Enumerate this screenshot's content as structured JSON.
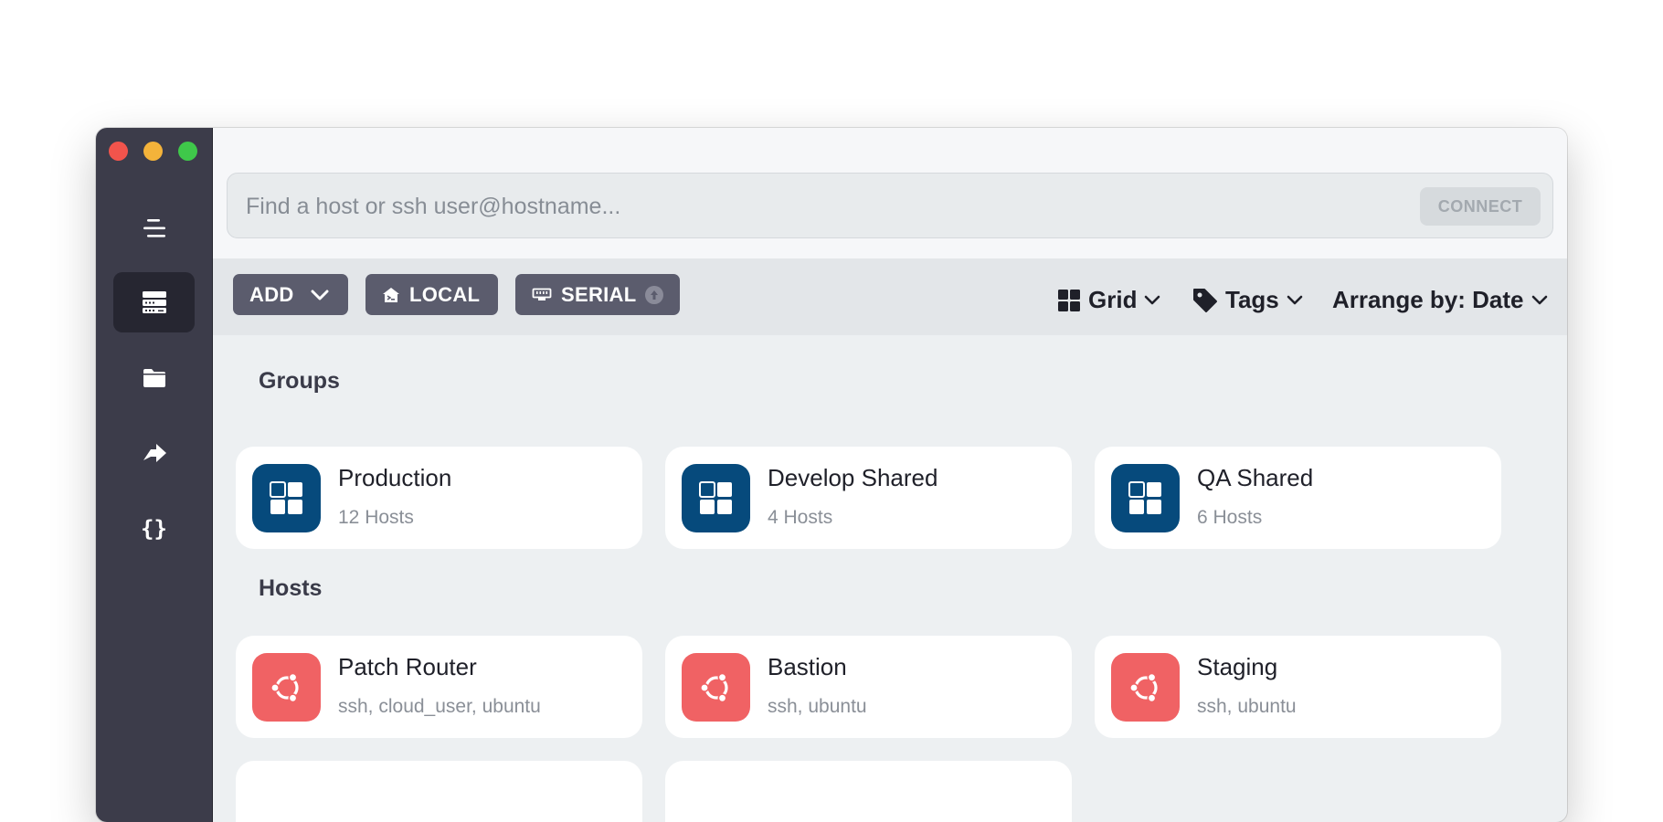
{
  "search": {
    "placeholder": "Find a host or ssh user@hostname...",
    "connect_label": "CONNECT"
  },
  "toolbar": {
    "add_label": "ADD",
    "local_label": "LOCAL",
    "serial_label": "SERIAL",
    "view_label": "Grid",
    "tags_label": "Tags",
    "arrange_label": "Arrange by: Date"
  },
  "sidebar": {
    "items": [
      {
        "icon": "menu-icon"
      },
      {
        "icon": "hosts-icon",
        "active": true
      },
      {
        "icon": "folder-icon"
      },
      {
        "icon": "port-forward-icon"
      },
      {
        "icon": "snippets-icon",
        "glyph": "{}"
      }
    ]
  },
  "groups": {
    "title": "Groups",
    "items": [
      {
        "name": "Production",
        "count": "12 Hosts"
      },
      {
        "name": "Develop Shared",
        "count": "4 Hosts"
      },
      {
        "name": "QA Shared",
        "count": "6 Hosts"
      }
    ]
  },
  "hosts": {
    "title": "Hosts",
    "items": [
      {
        "name": "Patch Router",
        "details": "ssh, cloud_user, ubuntu"
      },
      {
        "name": "Bastion",
        "details": "ssh, ubuntu"
      },
      {
        "name": "Staging",
        "details": "ssh, ubuntu"
      }
    ]
  },
  "colors": {
    "group_tile": "#064a7c",
    "host_tile": "#f06264",
    "sidebar": "#3c3c4a"
  }
}
